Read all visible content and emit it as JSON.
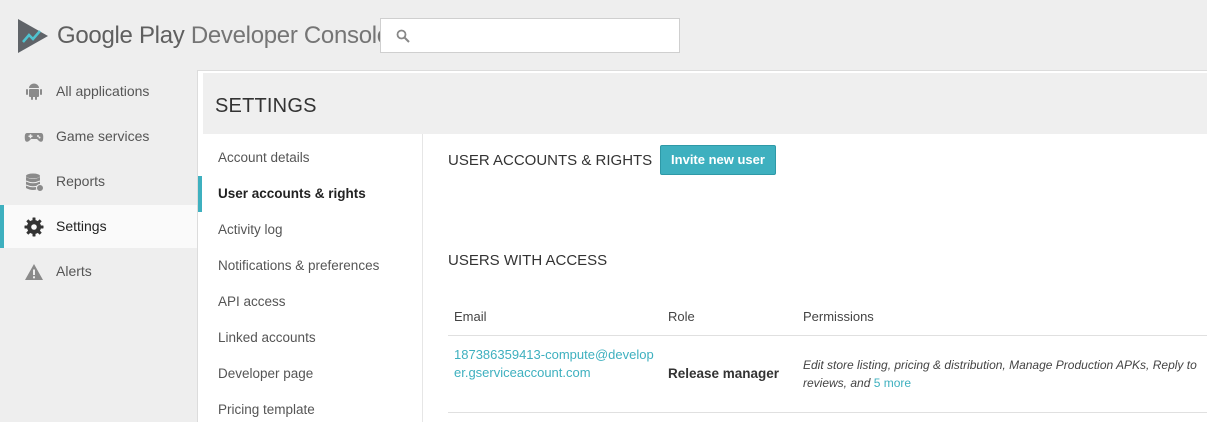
{
  "header": {
    "logo_google": "Google Play",
    "logo_console": "Developer Console",
    "search_placeholder": ""
  },
  "leftnav": {
    "items": [
      {
        "label": "All applications",
        "icon": "android-icon"
      },
      {
        "label": "Game services",
        "icon": "gamepad-icon"
      },
      {
        "label": "Reports",
        "icon": "database-icon"
      },
      {
        "label": "Settings",
        "icon": "gear-icon",
        "active": true
      },
      {
        "label": "Alerts",
        "icon": "warning-icon"
      }
    ]
  },
  "settings": {
    "title": "SETTINGS",
    "subnav": [
      {
        "label": "Account details"
      },
      {
        "label": "User accounts & rights",
        "active": true
      },
      {
        "label": "Activity log"
      },
      {
        "label": "Notifications & preferences"
      },
      {
        "label": "API access"
      },
      {
        "label": "Linked accounts"
      },
      {
        "label": "Developer page"
      },
      {
        "label": "Pricing template"
      }
    ]
  },
  "content": {
    "accounts_heading": "USER ACCOUNTS & RIGHTS",
    "invite_button": "Invite new user",
    "users_heading": "USERS WITH ACCESS",
    "table": {
      "headers": {
        "email": "Email",
        "role": "Role",
        "permissions": "Permissions"
      },
      "rows": [
        {
          "email": "187386359413-compute@developer.gserviceaccount.com",
          "role": "Release manager",
          "permissions": "Edit store listing, pricing & distribution, Manage Production APKs, Reply to reviews, and ",
          "more_link": "5 more"
        }
      ]
    }
  },
  "colors": {
    "accent": "#3eb0bf",
    "background": "#eeeeee",
    "card": "#ffffff"
  }
}
